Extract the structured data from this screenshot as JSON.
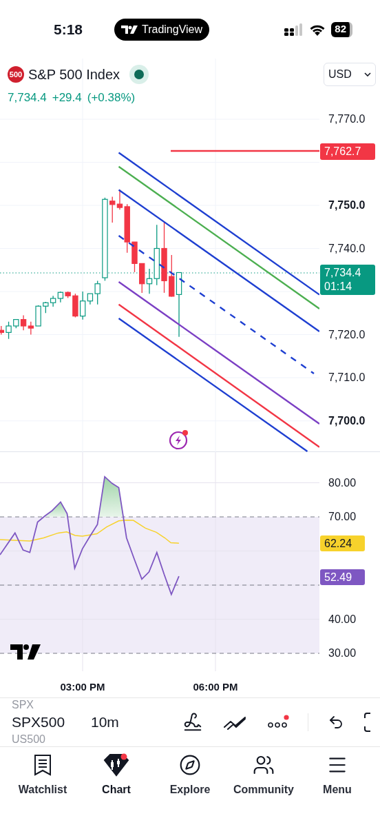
{
  "status_bar": {
    "time": "5:18",
    "app_pill": "TradingView",
    "battery": "82"
  },
  "symbol": {
    "badge": "500",
    "name": "S&P 500 Index",
    "market_open": true,
    "price": "7,734.4",
    "change": "+29.4",
    "change_percent": "(+0.38%)",
    "currency": "USD"
  },
  "price_axis": [
    {
      "text": "7,770.0",
      "emphasized": false
    },
    {
      "text": "7,750.0",
      "emphasized": true
    },
    {
      "text": "7,740.0",
      "emphasized": false
    },
    {
      "text": "7,720.0",
      "emphasized": false
    },
    {
      "text": "7,710.0",
      "emphasized": false
    },
    {
      "text": "7,700.0",
      "emphasized": true
    }
  ],
  "price_markers": [
    {
      "lines": [
        "7,762.7"
      ],
      "color": "#f23645"
    },
    {
      "lines": [
        "7,734.4",
        "01:14"
      ],
      "color": "#089981"
    }
  ],
  "rsi_axis": [
    {
      "text": "80.00"
    },
    {
      "text": "70.00"
    },
    {
      "text": "40.00"
    },
    {
      "text": "30.00"
    }
  ],
  "rsi_markers": [
    {
      "text": "62.24",
      "color": "#f7d22c"
    },
    {
      "text": "52.49",
      "color": "#7e57c2"
    }
  ],
  "time_axis": [
    "03:00 PM",
    "06:00 PM"
  ],
  "toolbar": {
    "symbol_above": "SPX",
    "symbol": "SPX500",
    "symbol_below": "US500",
    "interval": "10m",
    "alerts_dot": true
  },
  "nav": [
    {
      "kind": "watchlist",
      "label": "Watchlist",
      "selected": false
    },
    {
      "kind": "chart",
      "label": "Chart",
      "selected": true
    },
    {
      "kind": "explore",
      "label": "Explore",
      "selected": false
    },
    {
      "kind": "community",
      "label": "Community",
      "selected": false
    },
    {
      "kind": "menu",
      "label": "Menu",
      "selected": false
    }
  ]
}
